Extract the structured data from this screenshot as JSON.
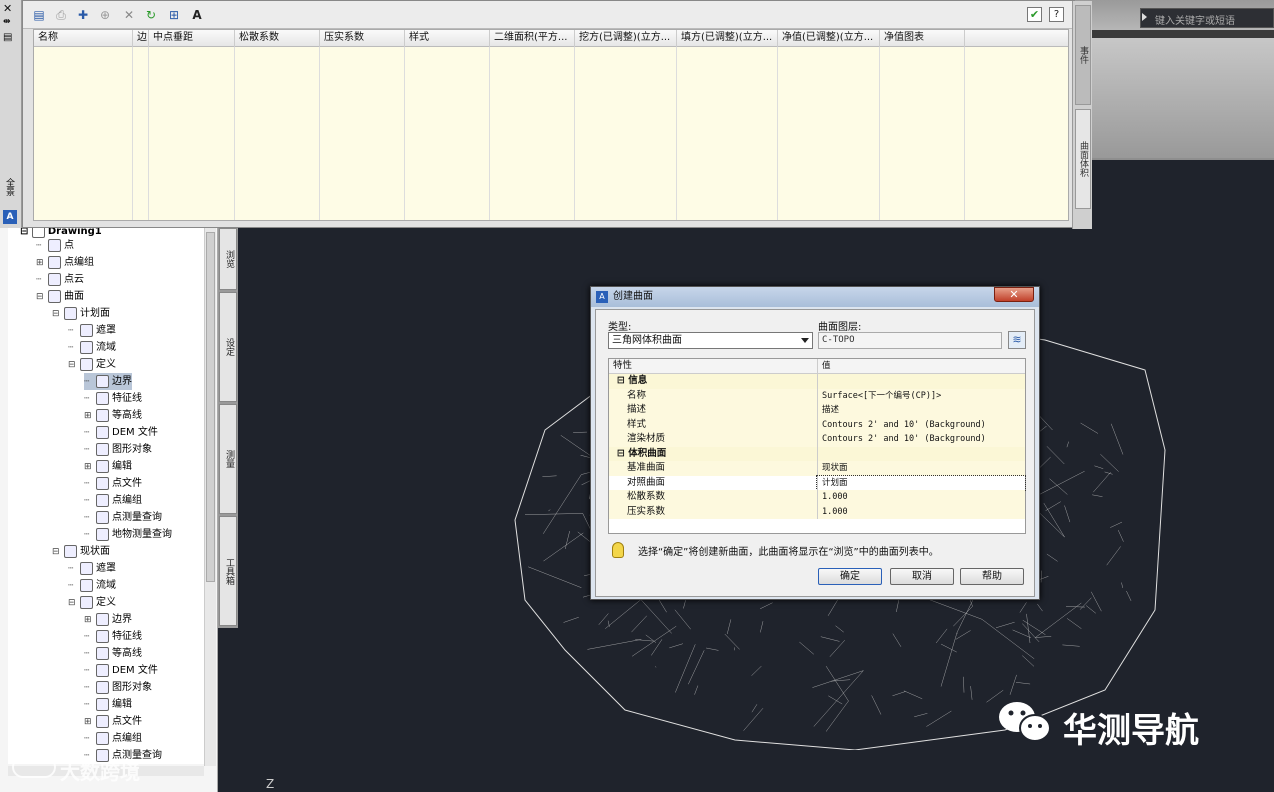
{
  "app": {
    "search_placeholder": "键入关键字或短语"
  },
  "palette_side": {
    "close": "✕",
    "pin": "⇹",
    "menu": "▤",
    "title": "全景"
  },
  "event_panel": {
    "columns": [
      "名称",
      "边",
      "中点垂距",
      "松散系数",
      "压实系数",
      "样式",
      "二维面积(平方...",
      "挖方(已调整)(立方...",
      "填方(已调整)(立方...",
      "净值(已调整)(立方...",
      "净值图表"
    ],
    "right_tabs": [
      "事件",
      "曲面体积"
    ]
  },
  "prospector": {
    "root": "Drawing1",
    "items": [
      {
        "label": "点",
        "level": 1
      },
      {
        "label": "点编组",
        "level": 1,
        "expand": "+"
      },
      {
        "label": "点云",
        "level": 1
      },
      {
        "label": "曲面",
        "level": 1,
        "expand": "−"
      },
      {
        "label": "计划面",
        "level": 2,
        "expand": "−"
      },
      {
        "label": "遮罩",
        "level": 3
      },
      {
        "label": "流域",
        "level": 3
      },
      {
        "label": "定义",
        "level": 3,
        "expand": "−"
      },
      {
        "label": "边界",
        "level": 4,
        "selected": true
      },
      {
        "label": "特征线",
        "level": 4
      },
      {
        "label": "等高线",
        "level": 4,
        "expand": "+"
      },
      {
        "label": "DEM 文件",
        "level": 4
      },
      {
        "label": "图形对象",
        "level": 4
      },
      {
        "label": "编辑",
        "level": 4,
        "expand": "+"
      },
      {
        "label": "点文件",
        "level": 4
      },
      {
        "label": "点编组",
        "level": 4
      },
      {
        "label": "点测量查询",
        "level": 4
      },
      {
        "label": "地物测量查询",
        "level": 4
      },
      {
        "label": "现状面",
        "level": 2,
        "expand": "−"
      },
      {
        "label": "遮罩",
        "level": 3
      },
      {
        "label": "流域",
        "level": 3
      },
      {
        "label": "定义",
        "level": 3,
        "expand": "−"
      },
      {
        "label": "边界",
        "level": 4,
        "expand": "+"
      },
      {
        "label": "特征线",
        "level": 4
      },
      {
        "label": "等高线",
        "level": 4
      },
      {
        "label": "DEM 文件",
        "level": 4
      },
      {
        "label": "图形对象",
        "level": 4
      },
      {
        "label": "编辑",
        "level": 4
      },
      {
        "label": "点文件",
        "level": 4,
        "expand": "+"
      },
      {
        "label": "点编组",
        "level": 4
      },
      {
        "label": "点测量查询",
        "level": 4
      }
    ],
    "side_tabs": [
      "浏览",
      "设定",
      "测量",
      "工具箱"
    ]
  },
  "dialog": {
    "title": "创建曲面",
    "type_label": "类型:",
    "type_value": "三角网体积曲面",
    "layer_label": "曲面图层:",
    "layer_value": "C-TOPO",
    "table_header": {
      "prop": "特性",
      "value": "值"
    },
    "rows": [
      {
        "cat": true,
        "prop": "信息",
        "value": ""
      },
      {
        "prop": "名称",
        "value": "Surface<[下一个编号(CP)]>"
      },
      {
        "prop": "描述",
        "value": "描述"
      },
      {
        "prop": "样式",
        "value": "Contours 2' and 10' (Background)"
      },
      {
        "prop": "渲染材质",
        "value": "Contours 2' and 10' (Background)"
      },
      {
        "cat": true,
        "prop": "体积曲面",
        "value": ""
      },
      {
        "prop": "基准曲面",
        "value": "现状面"
      },
      {
        "prop": "对照曲面",
        "value": "计划面"
      },
      {
        "prop": "松散系数",
        "value": "1.000"
      },
      {
        "prop": "压实系数",
        "value": "1.000"
      }
    ],
    "info_text": "选择“确定”将创建新曲面，此曲面将显示在“浏览”中的曲面列表中。",
    "buttons": {
      "ok": "确定",
      "cancel": "取消",
      "help": "帮助"
    }
  },
  "watermarks": {
    "left": "大数跨境",
    "right": "华测导航"
  },
  "ucs": "Z",
  "colors": {
    "bg": "#1f232c",
    "grid": "#fefce6",
    "mesh": "#cfcfcf"
  }
}
